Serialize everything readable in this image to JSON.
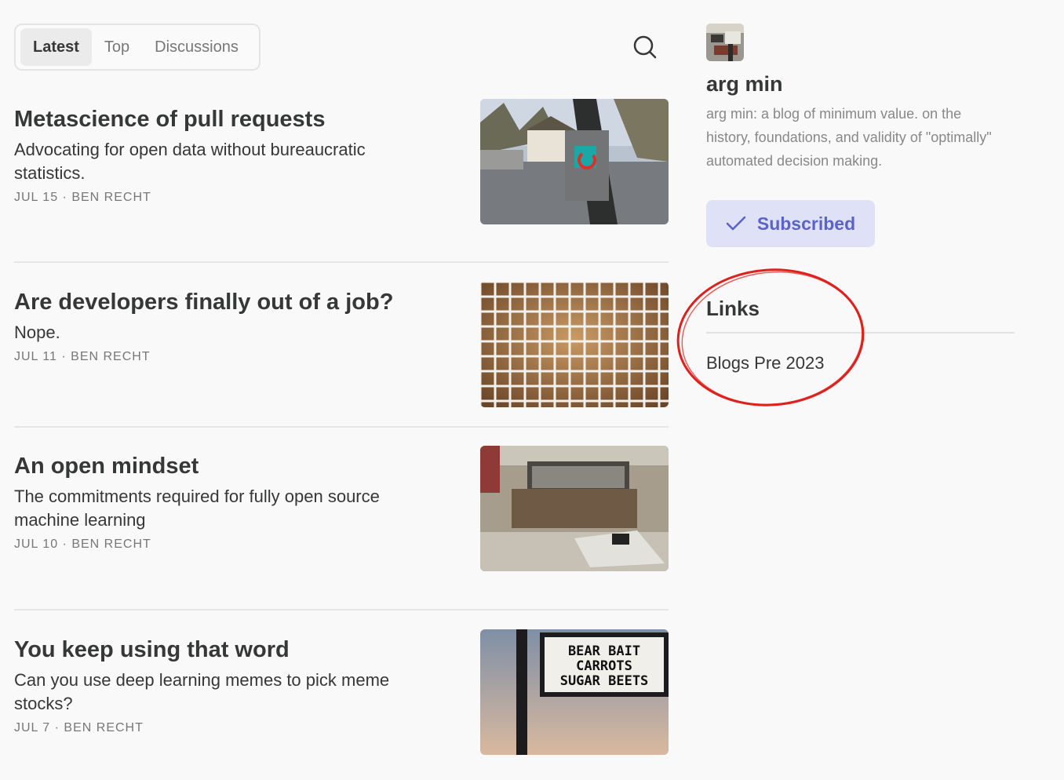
{
  "tabs": [
    "Latest",
    "Top",
    "Discussions"
  ],
  "search": {
    "icon": "search-icon"
  },
  "posts": [
    {
      "title": "Metascience of pull requests",
      "subtitle": "Advocating for open data without bureaucratic statistics.",
      "date": "JUL 15",
      "author": "BEN RECHT",
      "thumbnail": "traffic-sign-photo"
    },
    {
      "title": "Are developers finally out of a job?",
      "subtitle": "Nope.",
      "date": "JUL 11",
      "author": "BEN RECHT",
      "thumbnail": "grid-fence-photo"
    },
    {
      "title": "An open mindset",
      "subtitle": "The commitments required for fully open source machine learning",
      "date": "JUL 10",
      "author": "BEN RECHT",
      "thumbnail": "loading-dock-photo"
    },
    {
      "title": "You keep using that word",
      "subtitle": "Can you use deep learning memes to pick meme stocks?",
      "date": "JUL 7",
      "author": "BEN RECHT",
      "thumbnail": "sign-board-photo",
      "sign_text": [
        "BEAR BAIT",
        "CARROTS",
        "SUGAR BEETS"
      ]
    }
  ],
  "sidebar": {
    "name": "arg min",
    "description": "arg min: a blog of minimum value. on the history, foundations, and validity of \"optimally\" automated decision making.",
    "subscribe_label": "Subscribed",
    "links_heading": "Links",
    "links": [
      "Blogs Pre 2023"
    ]
  },
  "colors": {
    "accent": "#5b63c8",
    "accent_bg": "#dfe2f6",
    "annotation": "#e0201c"
  }
}
